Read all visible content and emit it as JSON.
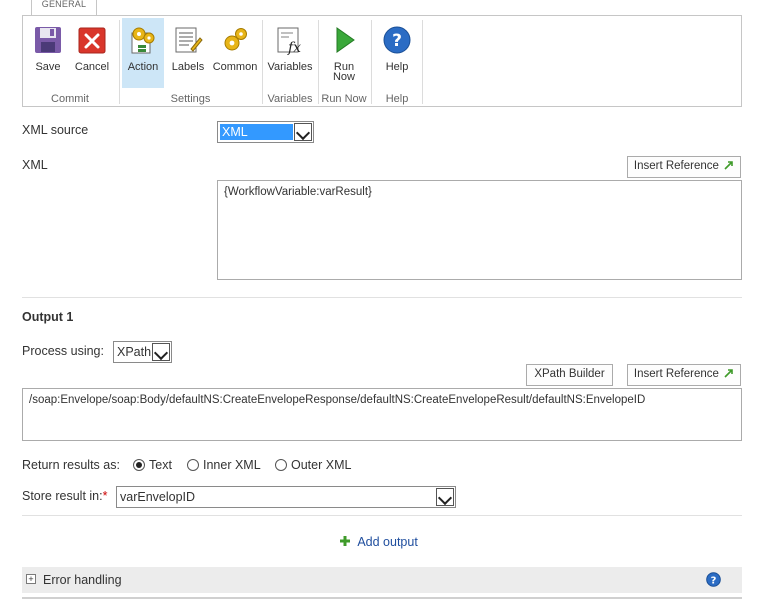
{
  "ribbon": {
    "tab": "GENERAL",
    "buttons": {
      "save": "Save",
      "cancel": "Cancel",
      "action": "Action",
      "labels": "Labels",
      "common": "Common",
      "variables": "Variables",
      "run_now": [
        "Run",
        "Now"
      ],
      "help": "Help"
    },
    "groups": {
      "commit": "Commit",
      "settings": "Settings",
      "variables": "Variables",
      "run_now": "Run Now",
      "help": "Help"
    }
  },
  "form": {
    "xml_source_label": "XML source",
    "xml_source_value": "XML",
    "xml_label": "XML",
    "insert_reference": "Insert Reference",
    "xml_value": "{WorkflowVariable:varResult}",
    "output_title": "Output 1",
    "process_using_label": "Process using:",
    "process_using_value": "XPath",
    "xpath_builder": "XPath Builder",
    "xpath_value": "/soap:Envelope/soap:Body/defaultNS:CreateEnvelopeResponse/defaultNS:CreateEnvelopeResult/defaultNS:EnvelopeID",
    "return_results_label": "Return results as:",
    "return_options": [
      "Text",
      "Inner XML",
      "Outer XML"
    ],
    "return_selected": "Text",
    "store_result_label": "Store result in:",
    "required_mark": "*",
    "store_result_value": "varEnvelopID",
    "add_output": "Add output",
    "error_handling": "Error handling"
  },
  "colors": {
    "accent_link": "#1f4e9e",
    "selection": "#3399ff",
    "active_ribbon": "#cde6f7",
    "required": "#cc0000",
    "plus_green": "#3f9b2a"
  }
}
